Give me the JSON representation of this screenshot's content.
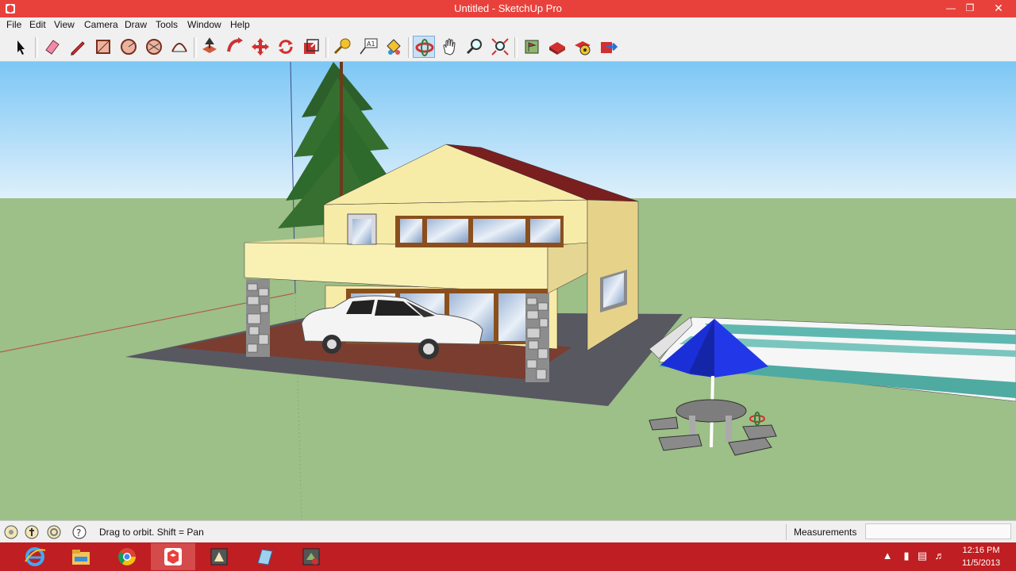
{
  "window": {
    "title": "Untitled - SketchUp Pro"
  },
  "menu": [
    "File",
    "Edit",
    "View",
    "Camera",
    "Draw",
    "Tools",
    "Window",
    "Help"
  ],
  "toolbar": {
    "tools": [
      "select-arrow-icon",
      "eraser-icon",
      "pencil-line-icon",
      "rectangle-icon",
      "circle-icon",
      "polygon-icon",
      "arc-icon",
      "push-pull-icon",
      "follow-me-icon",
      "move-icon",
      "rotate-icon",
      "scale-icon",
      "tape-measure-icon",
      "text-label-icon",
      "paint-bucket-icon",
      "orbit-icon",
      "pan-hand-icon",
      "zoom-icon",
      "zoom-extents-icon",
      "add-location-icon",
      "3d-warehouse-icon",
      "extension-warehouse-icon",
      "share-model-icon"
    ],
    "active_tool": "orbit-icon"
  },
  "status": {
    "hint": "Drag to orbit.  Shift = Pan",
    "measurements_label": "Measurements",
    "measurements_value": ""
  },
  "taskbar": {
    "apps": [
      "internet-explorer-icon",
      "file-explorer-icon",
      "chrome-icon",
      "sketchup-icon",
      "layout-icon",
      "style-builder-icon",
      "sketchup-viewer-icon"
    ],
    "active_app": "sketchup-icon"
  },
  "clock": {
    "time": "12:16 PM",
    "date": "11/5/2013"
  },
  "colors": {
    "titlebar": "#e8413c",
    "taskbar": "#bf1e22",
    "sky_top": "#7cc7f5",
    "sky_bottom": "#dff0fb",
    "ground": "#9dbf88",
    "house_wall": "#f7eba8",
    "roof": "#7a1f1f",
    "umbrella": "#1b2fd8",
    "pool_water": "#5fb8b0"
  }
}
